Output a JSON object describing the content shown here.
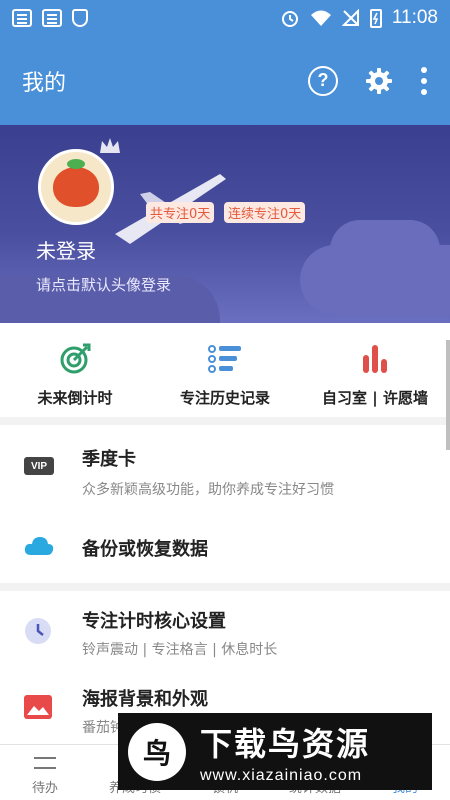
{
  "status_bar": {
    "time": "11:08"
  },
  "app_bar": {
    "title": "我的",
    "help_icon": "question-circle-icon",
    "settings_icon": "gear-icon",
    "more_icon": "more-vertical-icon"
  },
  "profile": {
    "total_focus_badge": "共专注0天",
    "streak_badge": "连续专注0天",
    "login_status": "未登录",
    "login_hint": "请点击默认头像登录"
  },
  "quick_actions": [
    {
      "label": "未来倒计时",
      "icon": "target-icon",
      "color": "#2e9e6b"
    },
    {
      "label": "专注历史记录",
      "icon": "history-list-icon",
      "color": "#4a90d9"
    },
    {
      "label": "自习室 | 许愿墙",
      "icon": "bar-chart-icon",
      "color": "#e0504a"
    }
  ],
  "menu": {
    "season_card": {
      "title": "季度卡",
      "subtitle": "众多新颖高级功能，助你养成专注好习惯",
      "icon_text": "VIP"
    },
    "backup": {
      "title": "备份或恢复数据",
      "icon": "cloud-icon"
    },
    "core_settings": {
      "title": "专注计时核心设置",
      "subtitle": "铃声震动 | 专注格言 | 休息时长",
      "icon": "clock-icon"
    },
    "appearance": {
      "title": "海报背景和外观",
      "subtitle": "番茄钟",
      "icon": "image-icon"
    }
  },
  "tabs": [
    {
      "label": "待办"
    },
    {
      "label": "养成习惯"
    },
    {
      "label": "锁机"
    },
    {
      "label": "统计数据"
    },
    {
      "label": "我的"
    }
  ],
  "watermark": {
    "logo_text": "鸟",
    "title": "下载鸟资源",
    "url": "www.xiazainiao.com"
  },
  "colors": {
    "primary": "#4a90d9",
    "banner": "#3b3f8f",
    "badge_text": "#e35a3c"
  }
}
